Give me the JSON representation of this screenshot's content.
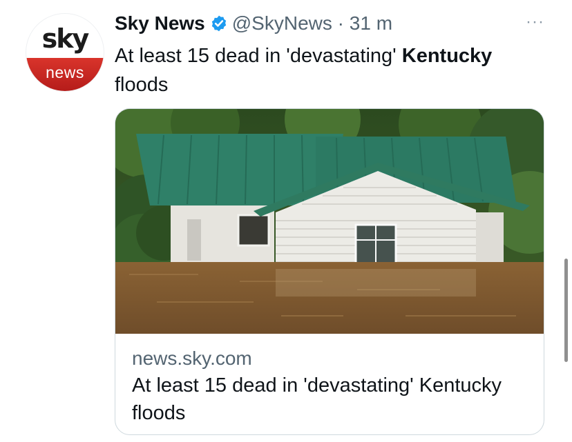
{
  "tweet": {
    "account_name": "Sky News",
    "handle": "@SkyNews",
    "separator": "·",
    "time": "31 m",
    "more_icon": "···",
    "text_before": "At least 15 dead in 'devastating' ",
    "text_bold": "Kentucky",
    "text_after": " floods"
  },
  "avatar": {
    "logo_top": "sky",
    "logo_bottom": "news"
  },
  "card": {
    "domain": "news.sky.com",
    "title": "At least 15 dead in 'devastating' Kentucky floods"
  },
  "colors": {
    "verified": "#1d9bf0",
    "brand_red": "#c8251f",
    "roof_green": "#2f7c61",
    "flood_water": "#7a5630"
  }
}
